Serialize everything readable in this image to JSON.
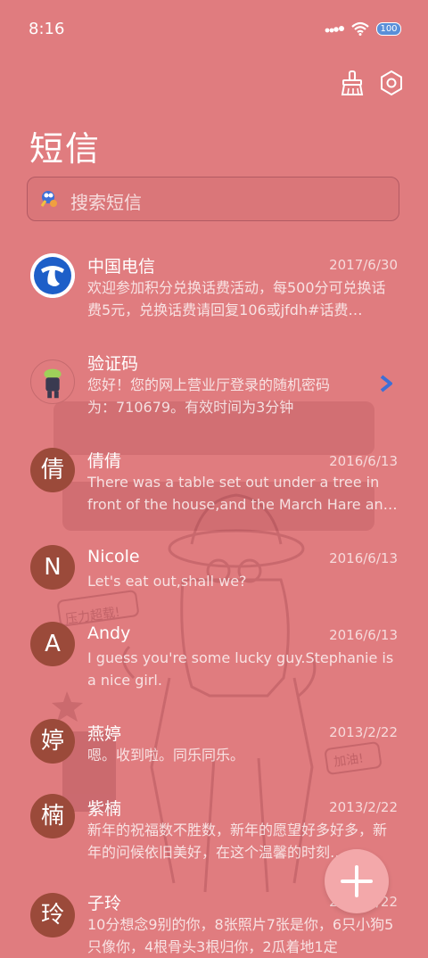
{
  "status": {
    "time": "8:16",
    "battery": "100"
  },
  "header": {
    "title": "短信"
  },
  "search": {
    "placeholder": "搜索短信"
  },
  "messages": [
    {
      "name": "中国电信",
      "date": "2017/6/30",
      "preview": "欢迎参加积分兑换话费活动，每500分可兑换话费5元，兑换话费请回复106或jfdh#话费…"
    },
    {
      "name": "验证码",
      "date": "",
      "preview": "您好！您的网上营业厅登录的随机密码为：710679。有效时间为3分钟"
    },
    {
      "name": "倩倩",
      "avatar": "倩",
      "date": "2016/6/13",
      "preview": "There was a table set out under a tree in front of the house,and the March Hare an…"
    },
    {
      "name": "Nicole",
      "avatar": "N",
      "date": "2016/6/13",
      "preview": "Let's eat out,shall we?"
    },
    {
      "name": "Andy",
      "avatar": "A",
      "date": "2016/6/13",
      "preview": "I guess you're some lucky guy.Stephanie is a nice girl."
    },
    {
      "name": "燕婷",
      "avatar": "婷",
      "date": "2013/2/22",
      "preview": "嗯。收到啦。同乐同乐。"
    },
    {
      "name": "紫楠",
      "avatar": "楠",
      "date": "2013/2/22",
      "preview": "新年的祝福数不胜数，新年的愿望好多好多，新年的问候依旧美好，在这个温馨的时刻…"
    },
    {
      "name": "子玲",
      "avatar": "玲",
      "date": "2013/2/22",
      "preview": "10分想念9别的你，8张照片7张是你，6只小狗5只像你，4根骨头3根归你，2瓜着地1定"
    }
  ],
  "wallpaper": {
    "sticker1": "压力超载!",
    "sticker2": "加油!"
  },
  "colors": {
    "background": "#e07c7f",
    "avatar": "#9b4a3a",
    "fab": "#f3a8aa",
    "chevron": "#3d6fd6"
  }
}
